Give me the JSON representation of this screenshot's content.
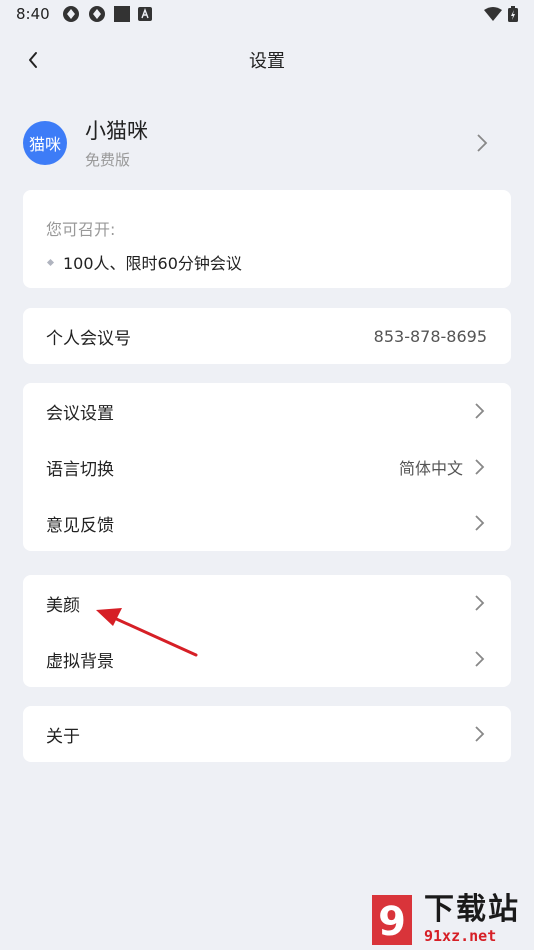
{
  "status_bar": {
    "time": "8:40"
  },
  "nav": {
    "title": "设置"
  },
  "profile": {
    "avatar_text": "猫咪",
    "name": "小猫咪",
    "plan": "免费版"
  },
  "capacity": {
    "label": "您可召开:",
    "item": "100人、限时60分钟会议"
  },
  "meeting_id": {
    "label": "个人会议号",
    "value": "853-878-8695"
  },
  "group1": [
    {
      "label": "会议设置",
      "value": ""
    },
    {
      "label": "语言切换",
      "value": "简体中文"
    },
    {
      "label": "意见反馈",
      "value": ""
    }
  ],
  "group2": [
    {
      "label": "美颜"
    },
    {
      "label": "虚拟背景"
    }
  ],
  "group3": [
    {
      "label": "关于"
    }
  ],
  "watermark": {
    "logo_text": "9",
    "line1": "下载站",
    "line2": "91xz.net"
  },
  "colors": {
    "accent": "#3d7cf7",
    "background": "#eef0f5",
    "card": "#ffffff",
    "arrow": "#d61f26"
  }
}
